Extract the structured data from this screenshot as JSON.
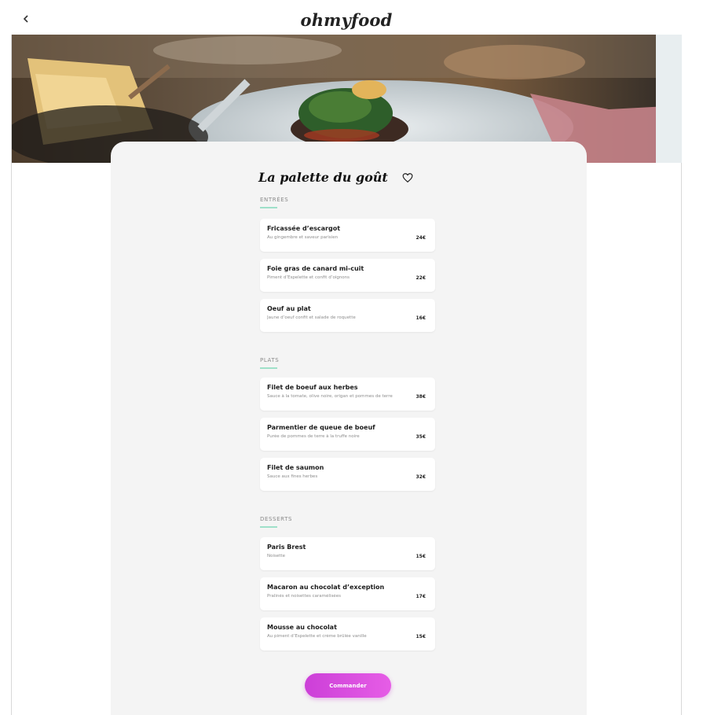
{
  "app": {
    "logo": "ohmyfood",
    "back_icon": "arrow-left-icon"
  },
  "restaurant": {
    "name": "La palette du goût",
    "favorite_icon": "heart-outline-icon"
  },
  "sections": [
    {
      "label": "ENTRÉES",
      "items": [
        {
          "name": "Fricassée d’escargot",
          "description": "Au gingembre et saveur parisien",
          "price": "24€"
        },
        {
          "name": "Foie gras de canard mi-cuit",
          "description": "Piment d’Espelette et confit d’oignons",
          "price": "22€"
        },
        {
          "name": "Oeuf au plat",
          "description": "Jaune d’oeuf confit et salade de roquette",
          "price": "16€"
        }
      ]
    },
    {
      "label": "PLATS",
      "items": [
        {
          "name": "Filet de boeuf aux herbes",
          "description": "Sauce à la tomate, olive noire, origan et pommes de terre",
          "price": "38€"
        },
        {
          "name": "Parmentier de queue de boeuf",
          "description": "Purée de pommes de terre à la truffe noire",
          "price": "35€"
        },
        {
          "name": "Filet de saumon",
          "description": "Sauce aux fines herbes",
          "price": "32€"
        }
      ]
    },
    {
      "label": "DESSERTS",
      "items": [
        {
          "name": "Paris Brest",
          "description": "Noisette",
          "price": "15€"
        },
        {
          "name": "Macaron au chocolat d’exception",
          "description": "Pralinés et noisettes caramélisées",
          "price": "17€"
        },
        {
          "name": "Mousse au chocolat",
          "description": "Au piment d’Espelette et crème brûlée vanille",
          "price": "15€"
        }
      ]
    }
  ],
  "order_button": {
    "label": "Commander"
  },
  "colors": {
    "accent_gradient_start": "#cc3fd8",
    "accent_gradient_end": "#e65de6",
    "section_underline": "#9fe0c9",
    "card_background": "#f4f4f4"
  }
}
